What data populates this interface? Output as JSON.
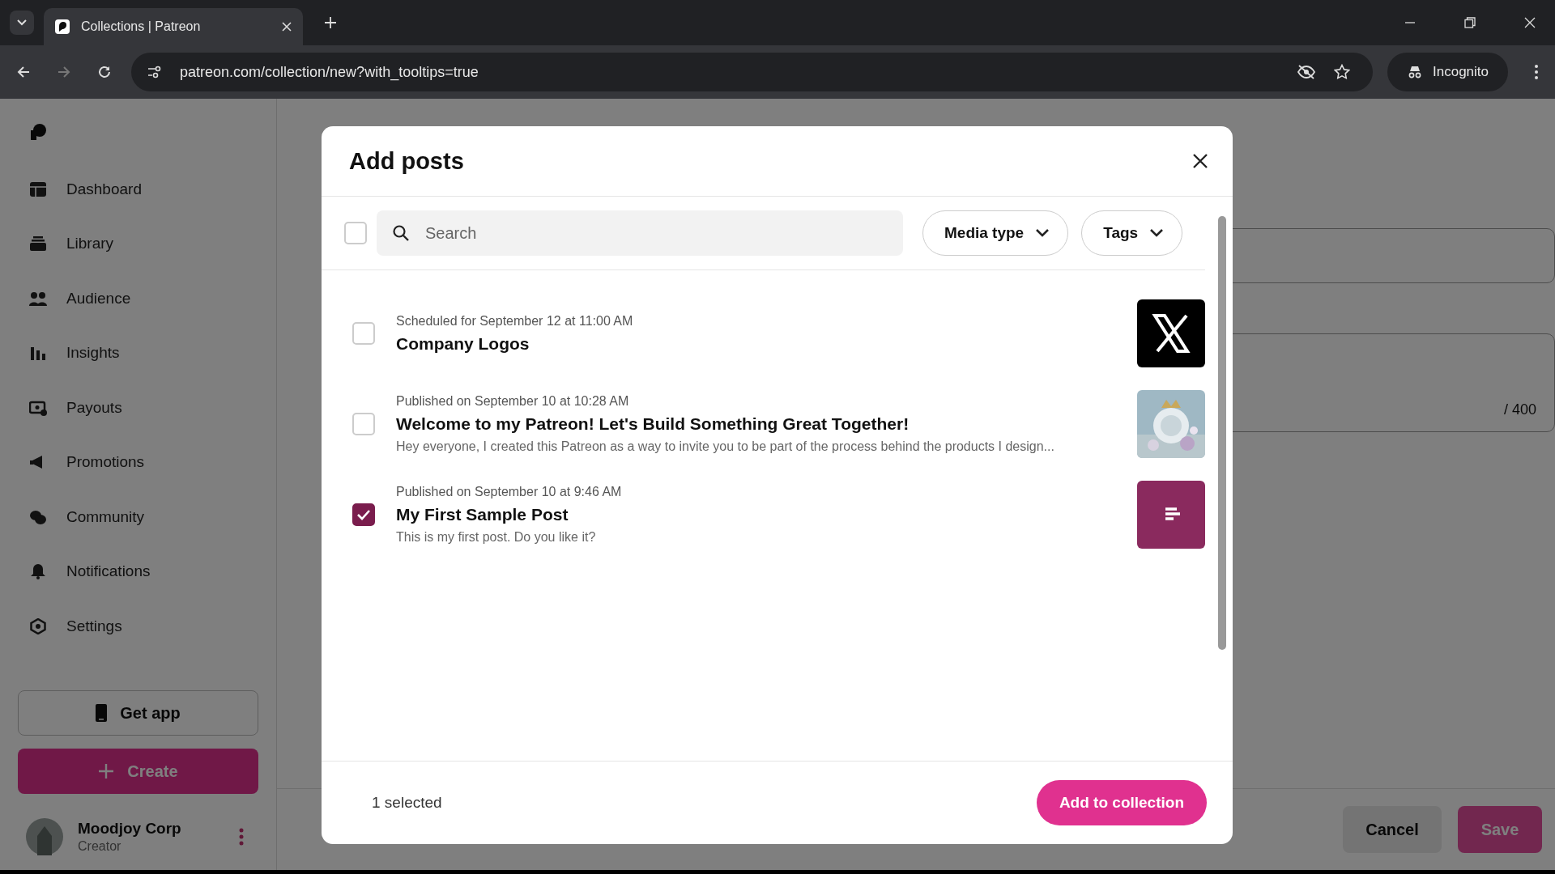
{
  "browser": {
    "tab_title": "Collections | Patreon",
    "url": "patreon.com/collection/new?with_tooltips=true",
    "profile_label": "Incognito"
  },
  "sidebar": {
    "items": [
      {
        "label": "Dashboard"
      },
      {
        "label": "Library"
      },
      {
        "label": "Audience"
      },
      {
        "label": "Insights"
      },
      {
        "label": "Payouts"
      },
      {
        "label": "Promotions"
      },
      {
        "label": "Community"
      },
      {
        "label": "Notifications"
      },
      {
        "label": "Settings"
      }
    ],
    "get_app": "Get app",
    "create": "Create",
    "user": {
      "name": "Moodjoy Corp",
      "role": "Creator"
    }
  },
  "background": {
    "char_count": "/ 400",
    "cancel": "Cancel",
    "save": "Save"
  },
  "modal": {
    "title": "Add posts",
    "select_all_checked": false,
    "search": {
      "placeholder": "Search"
    },
    "filters": [
      "Media type",
      "Tags"
    ],
    "posts": [
      {
        "date": "Scheduled for September 12 at 11:00 AM",
        "title": "Company Logos",
        "checked": false,
        "kind": "logo"
      },
      {
        "date": "Published on September 10 at 10:28 AM",
        "title": "Welcome to my Patreon! Let's Build Something Great Together!",
        "excerpt": "Hey everyone, I created this Patreon as a way to invite you to be part of the process behind the products I design...",
        "checked": false,
        "kind": "picture"
      },
      {
        "date": "Published on September 10 at 9:46 AM",
        "title": "My First Sample Post",
        "excerpt": "This is my first post. Do you like it?",
        "checked": true,
        "kind": "text"
      }
    ],
    "selected_count": "1 selected",
    "add_button": "Add to collection"
  }
}
